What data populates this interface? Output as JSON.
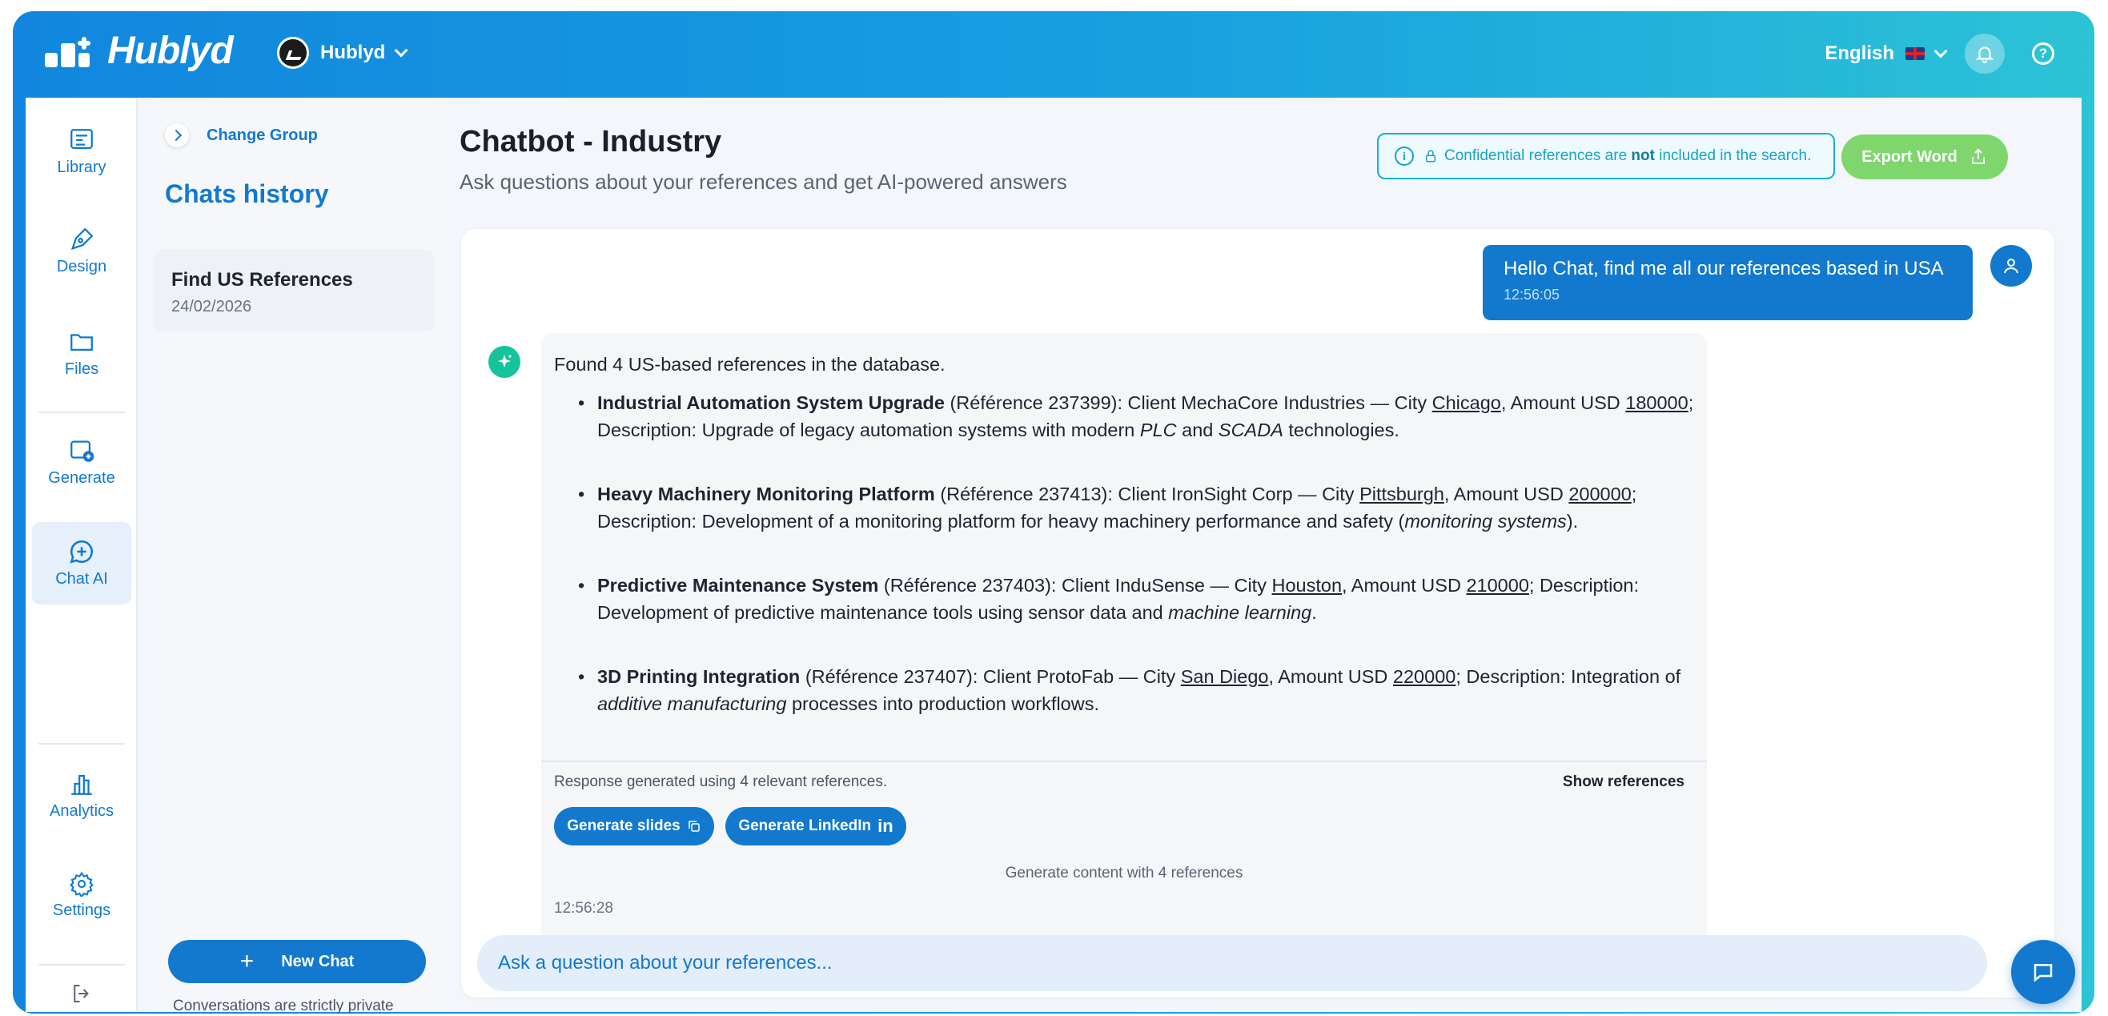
{
  "topbar": {
    "logo_text": "Hublyd",
    "org_name": "Hublyd",
    "language": "English",
    "help_symbol": "?"
  },
  "rail": {
    "items": [
      {
        "label": "Library",
        "icon": "library-icon"
      },
      {
        "label": "Design",
        "icon": "pen-icon"
      },
      {
        "label": "Files",
        "icon": "folder-icon"
      },
      {
        "label": "Generate",
        "icon": "generate-icon"
      },
      {
        "label": "Chat AI",
        "icon": "chat-plus-icon"
      },
      {
        "label": "Analytics",
        "icon": "bar-chart-icon"
      },
      {
        "label": "Settings",
        "icon": "gear-icon"
      }
    ],
    "active": "Chat AI"
  },
  "history": {
    "change_group": "Change Group",
    "title": "Chats history",
    "chats": [
      {
        "title": "Find US References",
        "date": "24/02/2026"
      }
    ],
    "new_chat": "New Chat",
    "private_note": "Conversations are strictly private"
  },
  "main": {
    "title": "Chatbot - Industry",
    "subtitle": "Ask questions about your references and get AI-powered answers",
    "confidential_pre": "Confidential references are",
    "confidential_bold": "not",
    "confidential_post": "included in the search.",
    "export_label": "Export Word"
  },
  "conversation": {
    "user_message": "Hello Chat, find me all our references based in USA",
    "user_time": "12:56:05",
    "bot_intro": "Found 4 US-based references in the database.",
    "references": [
      {
        "name": "Industrial Automation System Upgrade",
        "ref": "(Référence 237399): Client MechaCore Industries — City",
        "city": "Chicago",
        "amount_pre": ", Amount USD",
        "amount": "180000",
        "desc_pre": "; Description: Upgrade of legacy automation systems with modern",
        "em1": "PLC",
        "mid": "and",
        "em2": "SCADA",
        "desc_post": "technologies."
      },
      {
        "name": "Heavy Machinery Monitoring Platform",
        "ref": "(Référence 237413): Client IronSight Corp — City",
        "city": "Pittsburgh",
        "amount_pre": ", Amount USD",
        "amount": "200000",
        "desc_pre": "; Description: Development of a monitoring platform for heavy machinery performance and safety (",
        "em1": "monitoring systems",
        "mid": "",
        "em2": "",
        "desc_post": ")."
      },
      {
        "name": "Predictive Maintenance System",
        "ref": "(Référence 237403): Client InduSense — City",
        "city": "Houston",
        "amount_pre": ", Amount USD",
        "amount": "210000",
        "desc_pre": "; Description: Development of predictive maintenance tools using sensor data and",
        "em1": "machine learning",
        "mid": "",
        "em2": "",
        "desc_post": "."
      },
      {
        "name": "3D Printing Integration",
        "ref": "(Référence 237407): Client ProtoFab — City",
        "city": "San Diego",
        "amount_pre": ", Amount USD",
        "amount": "220000",
        "desc_pre": "; Description: Integration of",
        "em1": "additive manufacturing",
        "mid": "",
        "em2": "",
        "desc_post": "processes into production workflows."
      }
    ],
    "response_note": "Response generated using 4 relevant references.",
    "show_references": "Show references",
    "generate_slides": "Generate slides",
    "generate_linkedin": "Generate LinkedIn",
    "linkedin_mark": "in",
    "generate_note": "Generate content with 4 references",
    "bot_time": "12:56:28"
  },
  "input": {
    "placeholder": "Ask a question about your references..."
  },
  "colors": {
    "primary": "#1279cf",
    "accent_green": "#7ed66c",
    "bot_avatar": "#15c49a",
    "banner": "#17a3c8"
  }
}
